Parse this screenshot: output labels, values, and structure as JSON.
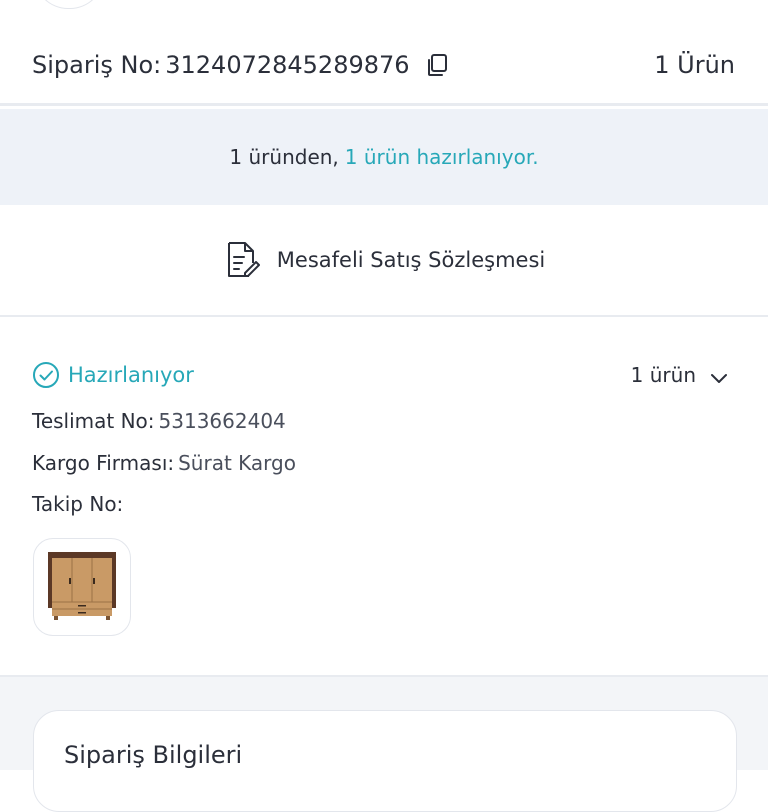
{
  "order": {
    "label": "Sipariş No:",
    "number": "3124072845289876",
    "item_count": "1 Ürün"
  },
  "banner": {
    "prefix": "1 üründen,",
    "highlight": "1 ürün hazırlanıyor."
  },
  "contract": {
    "label": "Mesafeli Satış Sözleşmesi"
  },
  "shipment": {
    "status": "Hazırlanıyor",
    "item_toggle": "1 ürün",
    "delivery_label": "Teslimat No:",
    "delivery_value": "5313662404",
    "carrier_label": "Kargo Firması:",
    "carrier_value": "Sürat Kargo",
    "tracking_label": "Takip No:",
    "tracking_value": ""
  },
  "info_card": {
    "title": "Sipariş Bilgileri"
  },
  "icons": {
    "copy": "copy-icon",
    "document": "document-edit-icon",
    "status": "check-circle-icon",
    "toggle": "chevron-down-icon"
  },
  "colors": {
    "accent": "#27a8b8",
    "banner_bg": "#eef2f8",
    "text": "#2b2f3a"
  }
}
